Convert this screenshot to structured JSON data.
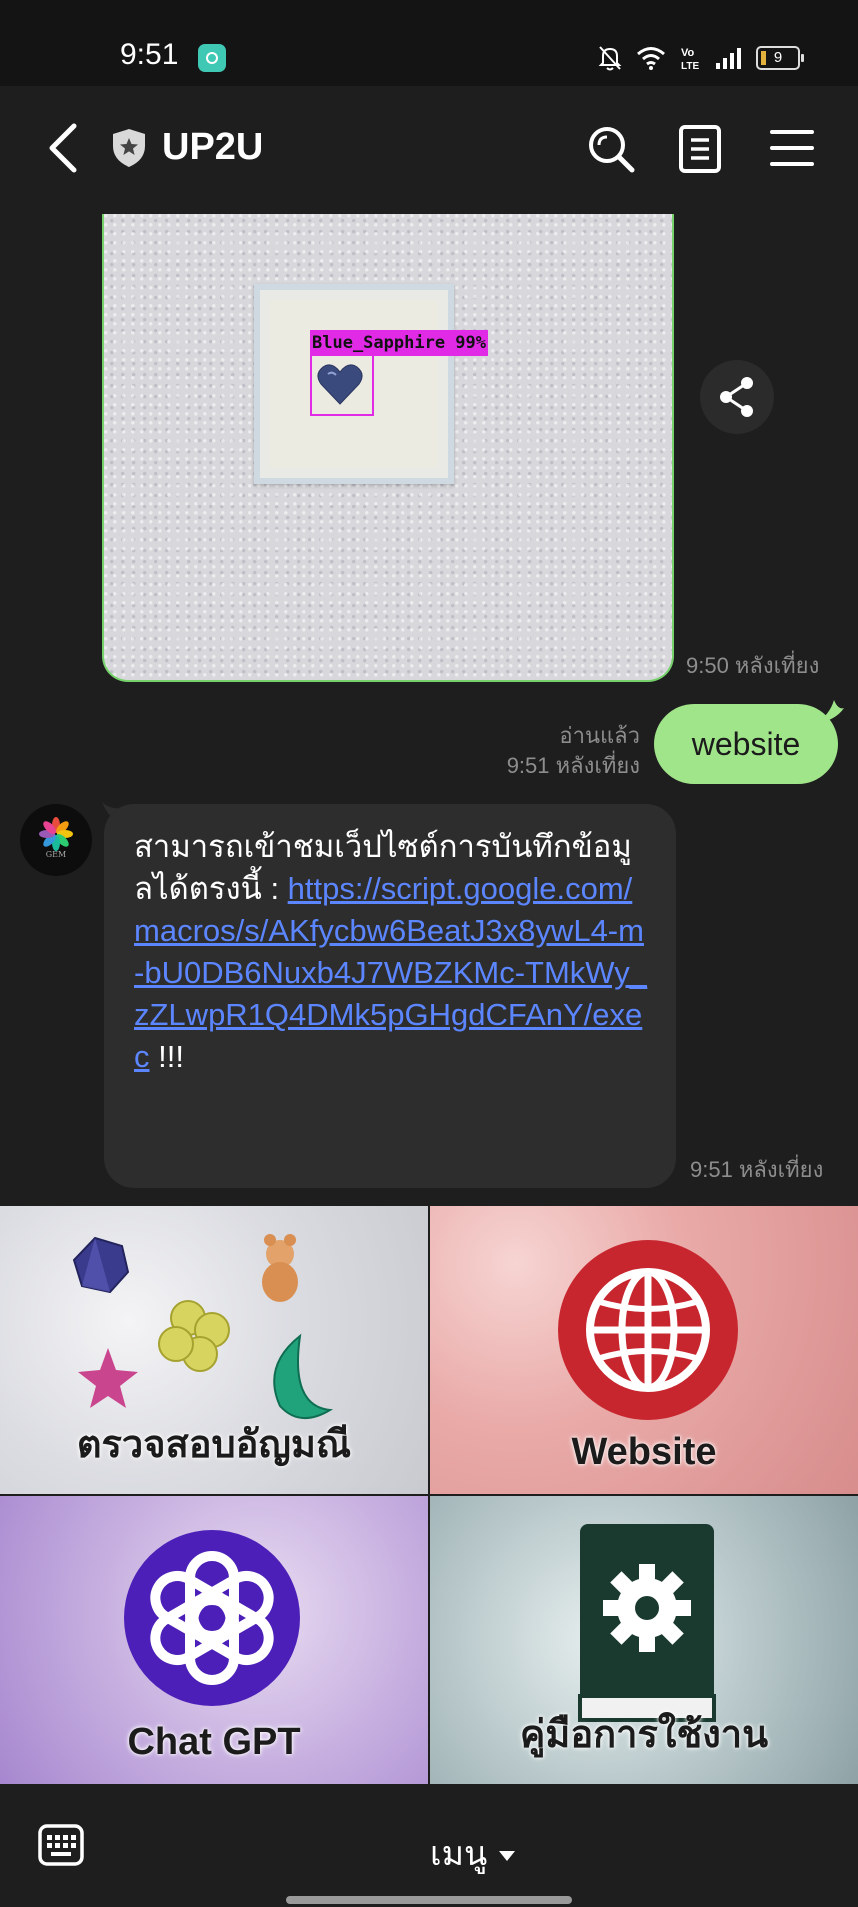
{
  "status_bar": {
    "time": "9:51",
    "battery": "9"
  },
  "header": {
    "title": "UP2U"
  },
  "messages": {
    "image": {
      "detection_label": "Blue_Sapphire 99%",
      "time": "9:50 หลังเที่ยง"
    },
    "sent": {
      "text": "website",
      "read_label": "อ่านแล้ว",
      "time": "9:51 หลังเที่ยง"
    },
    "received": {
      "avatar_label": "GEM",
      "text": "สามารถเข้าชมเว็ปไซต์การบันทึกข้อมูลได้ตรงนี้ : ",
      "link": "https://script.google.com/macros/s/AKfycbw6BeatJ3x8ywL4-m-bU0DB6Nuxb4J7WBZKMc-TMkWy_zZLwpR1Q4DMk5pGHgdCFAnY/exec",
      "suffix": " !!!",
      "time": "9:51 หลังเที่ยง"
    }
  },
  "rich_menu": {
    "items": [
      {
        "label": "ตรวจสอบอัญมณี",
        "icon": "gems-icon"
      },
      {
        "label": "Website",
        "icon": "globe-icon"
      },
      {
        "label": "Chat GPT",
        "icon": "chatgpt-icon"
      },
      {
        "label": "คู่มือการใช้งาน",
        "icon": "manual-book-icon"
      }
    ]
  },
  "bottom_bar": {
    "menu_label": "เมนู"
  },
  "colors": {
    "sent_bubble": "#a1e58b",
    "link": "#5c86ff",
    "detection": "#e02ae6"
  }
}
